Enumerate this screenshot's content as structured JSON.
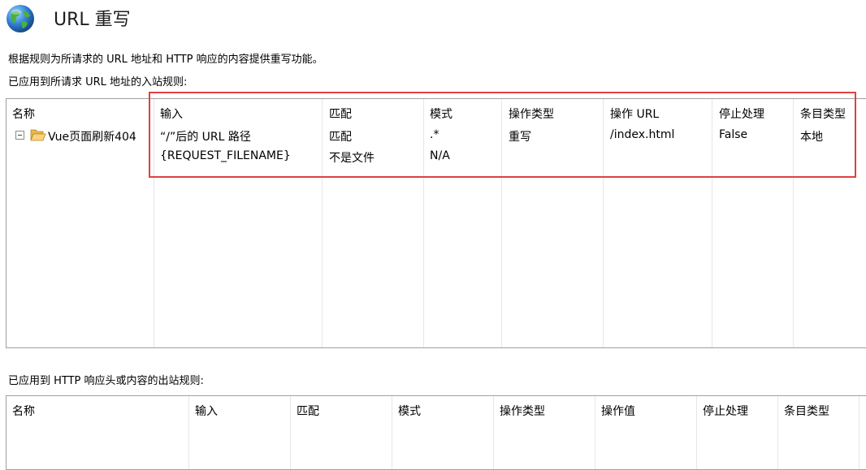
{
  "header": {
    "icon": "globe-icon",
    "title": "URL 重写"
  },
  "description": "根据规则为所请求的 URL 地址和 HTTP 响应的内容提供重写功能。",
  "inbound": {
    "label": "已应用到所请求 URL 地址的入站规则:",
    "columns": [
      "名称",
      "输入",
      "匹配",
      "模式",
      "操作类型",
      "操作 URL",
      "停止处理",
      "条目类型"
    ],
    "rule": {
      "name": "Vue页面刷新404",
      "conditions": [
        {
          "input": "“/”后的 URL 路径",
          "match": "匹配",
          "pattern": ".*",
          "action_type": "重写",
          "action_url": "/index.html",
          "stop": "False",
          "entry_type": "本地"
        },
        {
          "input": "{REQUEST_FILENAME}",
          "match": "不是文件",
          "pattern": "N/A"
        }
      ]
    }
  },
  "outbound": {
    "label": "已应用到 HTTP 响应头或内容的出站规则:",
    "columns": [
      "名称",
      "输入",
      "匹配",
      "模式",
      "操作类型",
      "操作值",
      "停止处理",
      "条目类型"
    ]
  },
  "colors": {
    "highlight": "#e04040",
    "border": "#a0a0a0",
    "grid_line": "#e6e6e6"
  }
}
